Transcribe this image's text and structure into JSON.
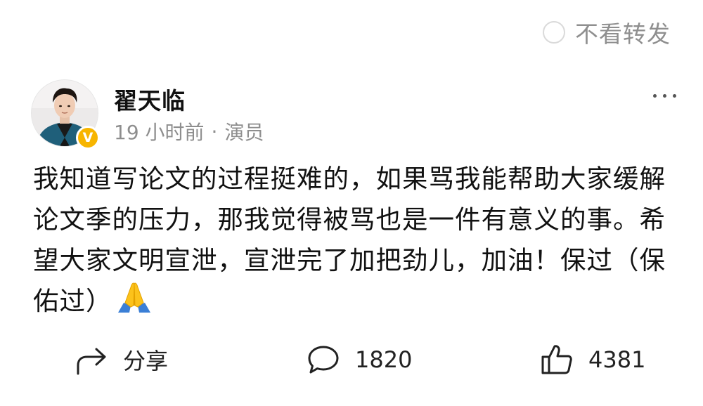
{
  "header": {
    "no_repost_label": "不看转发"
  },
  "post": {
    "author": {
      "name": "翟天临",
      "verified_badge_letter": "V",
      "badge_color": "#f7b500"
    },
    "time": "19 小时前",
    "separator": "·",
    "source": "演员",
    "text": "我知道写论文的过程挺难的，如果骂我能帮助大家缓解论文季的压力，那我觉得被骂也是一件有意义的事。希望大家文明宣泄，宣泄完了加把劲儿，加油！保过（保佑过）",
    "emoji": "folded-hands"
  },
  "actions": {
    "share_label": "分享",
    "comment_count": "1820",
    "like_count": "4381"
  }
}
